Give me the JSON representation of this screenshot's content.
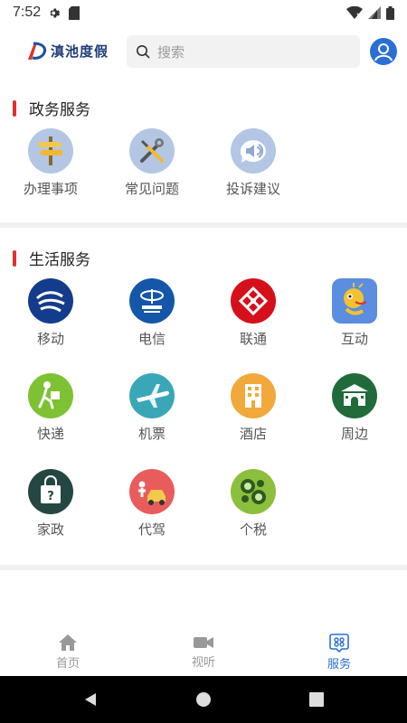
{
  "status_bar": {
    "time": "7:52"
  },
  "header": {
    "logo_text": "滇池度假",
    "search_placeholder": "搜索"
  },
  "gov_services": {
    "title": "政务服务",
    "items": [
      {
        "label": "办理事项",
        "icon": "signpost-icon"
      },
      {
        "label": "常见问题",
        "icon": "tools-icon"
      },
      {
        "label": "投诉建议",
        "icon": "speaker-icon"
      }
    ]
  },
  "life_services": {
    "title": "生活服务",
    "items": [
      {
        "label": "移动",
        "icon": "china-mobile-icon"
      },
      {
        "label": "电信",
        "icon": "china-telecom-icon"
      },
      {
        "label": "联通",
        "icon": "china-unicom-icon"
      },
      {
        "label": "互动",
        "icon": "dragon-icon"
      },
      {
        "label": "快递",
        "icon": "courier-icon"
      },
      {
        "label": "机票",
        "icon": "airplane-icon"
      },
      {
        "label": "酒店",
        "icon": "hotel-icon"
      },
      {
        "label": "周边",
        "icon": "gate-icon"
      },
      {
        "label": "家政",
        "icon": "housekeeping-icon"
      },
      {
        "label": "代驾",
        "icon": "chauffeur-icon"
      },
      {
        "label": "个税",
        "icon": "tax-icon"
      }
    ]
  },
  "tab_bar": {
    "tabs": [
      {
        "label": "首页",
        "icon": "home-icon",
        "active": false
      },
      {
        "label": "视听",
        "icon": "video-icon",
        "active": false
      },
      {
        "label": "服务",
        "icon": "service-icon",
        "active": true
      }
    ]
  },
  "colors": {
    "accent": "#2a6fd6",
    "section_bar": "#e0302e"
  }
}
